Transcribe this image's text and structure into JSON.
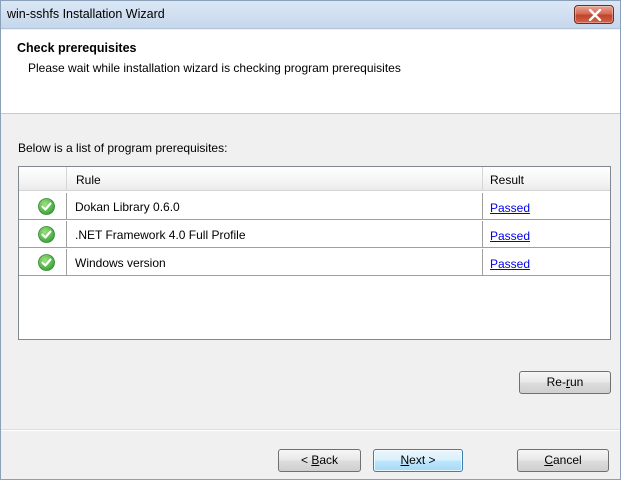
{
  "window": {
    "title": "win-sshfs Installation Wizard"
  },
  "header": {
    "title": "Check prerequisites",
    "subtitle": "Please wait while installation wizard is checking program prerequisites"
  },
  "main": {
    "list_caption": "Below is a list of program prerequisites:",
    "columns": {
      "rule": "Rule",
      "result": "Result"
    },
    "rows": [
      {
        "rule": "Dokan Library 0.6.0",
        "result": "Passed",
        "status_icon": "check-circle-icon"
      },
      {
        "rule": ".NET Framework 4.0 Full Profile",
        "result": "Passed",
        "status_icon": "check-circle-icon"
      },
      {
        "rule": "Windows version",
        "result": "Passed",
        "status_icon": "check-circle-icon"
      }
    ]
  },
  "buttons": {
    "rerun_prefix": "Re-",
    "rerun_mnemonic": "r",
    "rerun_suffix": "un",
    "back_prefix": "< ",
    "back_mnemonic": "B",
    "back_suffix": "ack",
    "next_mnemonic": "N",
    "next_suffix": "ext >",
    "cancel_mnemonic": "C",
    "cancel_suffix": "ancel"
  },
  "colors": {
    "status_passed": "#3aa63a",
    "link": "#0000ee",
    "close_button": "#c1432c"
  }
}
